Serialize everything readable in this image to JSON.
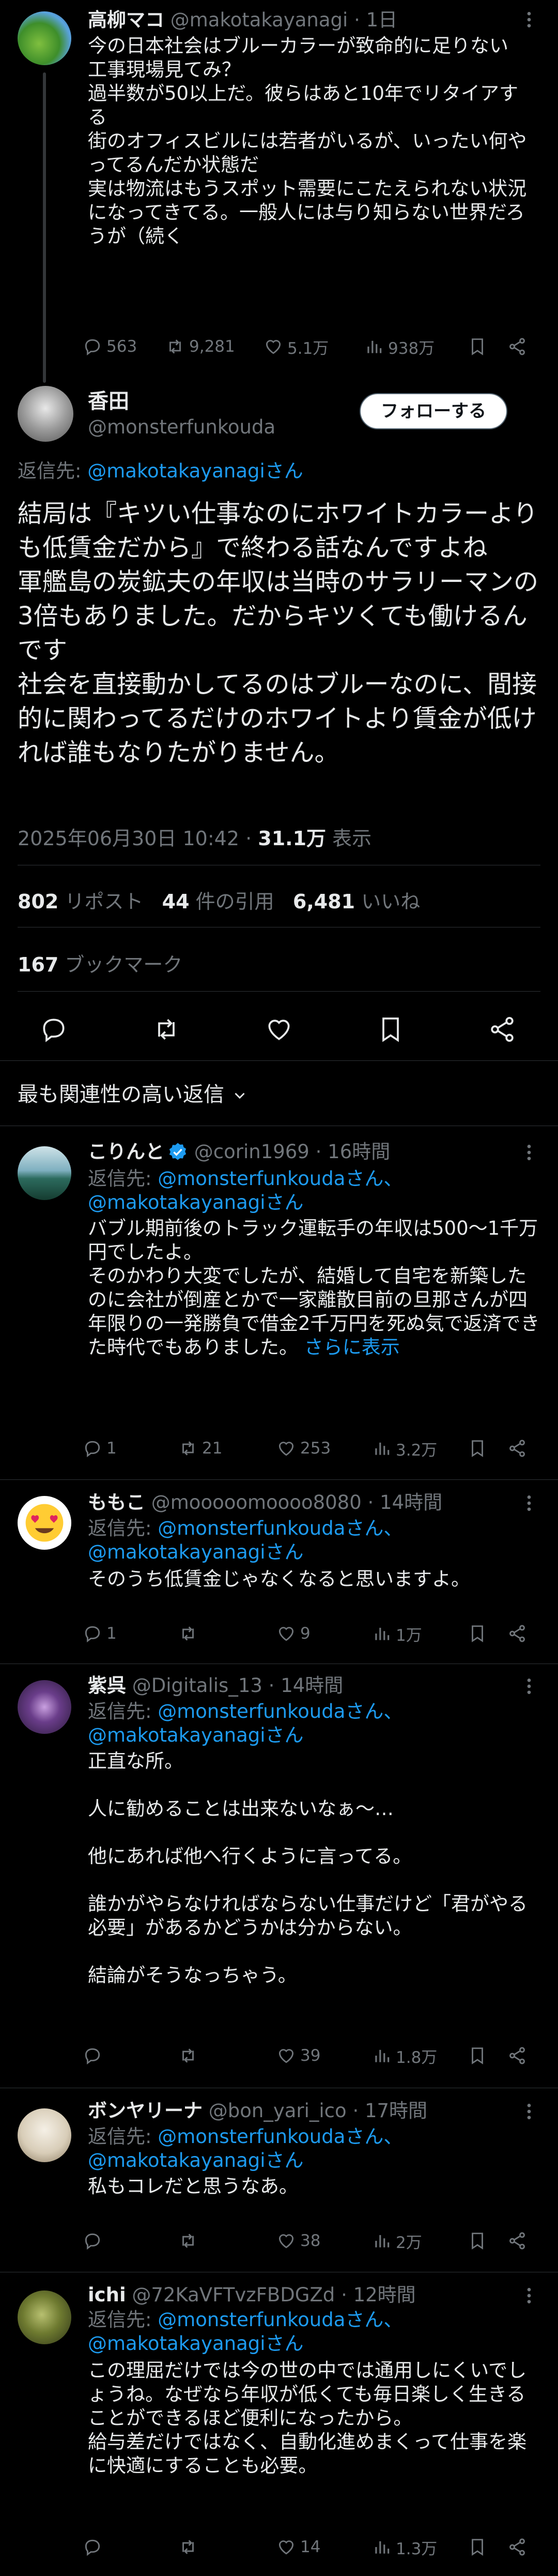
{
  "thread_parent": {
    "name": "高柳マコ",
    "handle": "@makotakayanagi",
    "time": "· 1日",
    "text": "今の日本社会はブルーカラーが致命的に足りない\n工事現場見てみ？\n過半数が50以上だ。彼らはあと10年でリタイアする\n街のオフィスビルには若者がいるが、いったい何やってるんだか状態だ\n実は物流はもうスポット需要にこたえられない状況になってきてる。一般人には与り知らない世界だろうが（続く",
    "replies": "563",
    "reposts": "9,281",
    "likes": "5.1万",
    "views": "938万"
  },
  "main_tweet": {
    "name": "香田",
    "handle": "@monsterfunkouda",
    "follow_label": "フォローする",
    "reply_to_prefix": "返信先: ",
    "reply_to_handle": "@makotakayanagiさん",
    "text": "結局は『キツい仕事なのにホワイトカラーよりも低賃金だから』で終わる話なんですよね\n軍艦島の炭鉱夫の年収は当時のサラリーマンの3倍もありました。だからキツくても働けるんです\n社会を直接動かしてるのはブルーなのに、間接的に関わってるだけのホワイトより賃金が低ければ誰もなりたがりません。",
    "timestamp": "2025年06月30日 10:42 · ",
    "views_count": "31.1万",
    "views_label": " 表示",
    "reposts_count": "802",
    "reposts_label": " リポスト",
    "quotes_count": "44",
    "quotes_label": " 件の引用",
    "likes_count": "6,481",
    "likes_label": " いいね",
    "bookmarks_count": "167",
    "bookmarks_label": " ブックマーク"
  },
  "sort_label": "最も関連性の高い返信",
  "replies": [
    {
      "name": "こりんと",
      "verified": true,
      "handle": "@corin1969",
      "time": "· 16時間",
      "reply_to_prefix": "返信先: ",
      "reply_to_1": "@monsterfunkoudaさん、",
      "reply_to_2": "@makotakayanagiさん",
      "text": "バブル期前後のトラック運転手の年収は500〜1千万円でしたよ。\nそのかわり大変でしたが、結婚して自宅を新築したのに会社が倒産とかで一家離散目前の旦那さんが四年限りの一発勝負で借金2千万円を死ぬ気で返済できた時代でもありました。",
      "more_label": "さらに表示",
      "replies": "1",
      "reposts": "21",
      "likes": "253",
      "views": "3.2万"
    },
    {
      "name": "ももこ",
      "handle": "@mooooomoooo8080",
      "time": "· 14時間",
      "reply_to_prefix": "返信先: ",
      "reply_to_1": "@monsterfunkoudaさん、",
      "reply_to_2": "@makotakayanagiさん",
      "text": "そのうち低賃金じゃなくなると思いますよ。",
      "replies": "1",
      "reposts": "",
      "likes": "9",
      "views": "1万"
    },
    {
      "name": "紫呉",
      "handle": "@Digitalis_13",
      "time": "· 14時間",
      "reply_to_prefix": "返信先: ",
      "reply_to_1": "@monsterfunkoudaさん、",
      "reply_to_2": "@makotakayanagiさん",
      "text": "正直な所。\n\n人に勧めることは出来ないなぁ〜…\n\n他にあれば他へ行くように言ってる。\n\n誰かがやらなければならない仕事だけど「君がやる必要」があるかどうかは分からない。\n\n結論がそうなっちゃう。",
      "replies": "",
      "reposts": "",
      "likes": "39",
      "views": "1.8万"
    },
    {
      "name": "ボンヤリーナ",
      "handle": "@bon_yari_ico",
      "time": "· 17時間",
      "reply_to_prefix": "返信先: ",
      "reply_to_1": "@monsterfunkoudaさん、",
      "reply_to_2": "@makotakayanagiさん",
      "text": "私もコレだと思うなあ。",
      "replies": "",
      "reposts": "",
      "likes": "38",
      "views": "2万"
    },
    {
      "name": "ichi",
      "handle": "@72KaVFTvzFBDGZd",
      "time": "· 12時間",
      "reply_to_prefix": "返信先: ",
      "reply_to_1": "@monsterfunkoudaさん、",
      "reply_to_2": "@makotakayanagiさん",
      "text": "この理屈だけでは今の世の中では通用しにくいでしょうね。なぜなら年収が低くても毎日楽しく生きることができるほど便利になったから。\n給与差だけではなく、自動化進めまくって仕事を楽に快適にすることも必要。",
      "replies": "",
      "reposts": "",
      "likes": "14",
      "views": "1.3万"
    }
  ],
  "colors": {
    "background": "#000000",
    "text": "#e7e9ea",
    "secondary": "#71767b",
    "link": "#1d9bf0",
    "border": "#2f3336"
  }
}
